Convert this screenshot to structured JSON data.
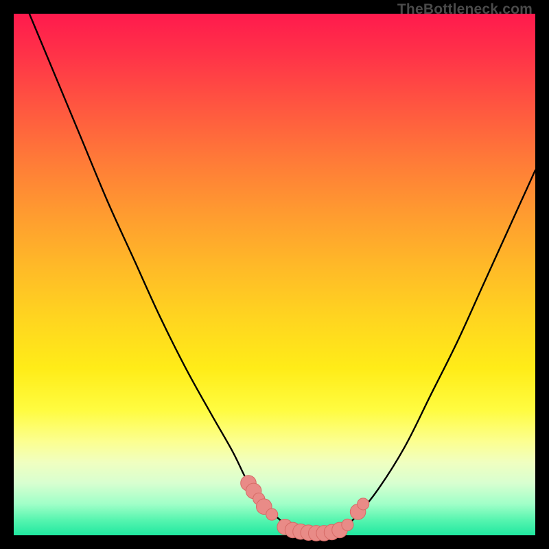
{
  "watermark": "TheBottleneck.com",
  "chart_data": {
    "type": "line",
    "title": "",
    "xlabel": "",
    "ylabel": "",
    "xlim": [
      0,
      100
    ],
    "ylim": [
      0,
      100
    ],
    "grid": false,
    "legend": false,
    "series": [
      {
        "name": "left-curve",
        "x": [
          3,
          8,
          13,
          18,
          23,
          28,
          33,
          38,
          42,
          45,
          48,
          51,
          54
        ],
        "y": [
          100,
          88,
          76,
          64,
          53,
          42,
          32,
          23,
          16,
          10,
          6,
          3,
          1
        ]
      },
      {
        "name": "right-curve",
        "x": [
          63,
          66,
          70,
          75,
          80,
          85,
          90,
          95,
          100
        ],
        "y": [
          1,
          4,
          9,
          17,
          27,
          37,
          48,
          59,
          70
        ]
      },
      {
        "name": "valley-floor",
        "x": [
          54,
          56,
          58,
          60,
          62,
          63
        ],
        "y": [
          1,
          0.5,
          0.3,
          0.3,
          0.5,
          1
        ]
      }
    ],
    "markers": [
      {
        "series": "left-curve",
        "x": 45,
        "y": 10,
        "r": 1.6
      },
      {
        "series": "left-curve",
        "x": 46,
        "y": 8.5,
        "r": 1.6
      },
      {
        "series": "left-curve",
        "x": 47,
        "y": 7,
        "r": 1.0
      },
      {
        "series": "left-curve",
        "x": 48,
        "y": 5.5,
        "r": 1.6
      },
      {
        "series": "left-curve",
        "x": 49.5,
        "y": 4,
        "r": 1.0
      },
      {
        "series": "valley-floor",
        "x": 52,
        "y": 1.6,
        "r": 1.6
      },
      {
        "series": "valley-floor",
        "x": 53.5,
        "y": 1.0,
        "r": 1.6
      },
      {
        "series": "valley-floor",
        "x": 55,
        "y": 0.7,
        "r": 1.6
      },
      {
        "series": "valley-floor",
        "x": 56.5,
        "y": 0.5,
        "r": 1.6
      },
      {
        "series": "valley-floor",
        "x": 58,
        "y": 0.4,
        "r": 1.6
      },
      {
        "series": "valley-floor",
        "x": 59.5,
        "y": 0.4,
        "r": 1.6
      },
      {
        "series": "valley-floor",
        "x": 61,
        "y": 0.6,
        "r": 1.6
      },
      {
        "series": "valley-floor",
        "x": 62.5,
        "y": 1.0,
        "r": 1.6
      },
      {
        "series": "right-curve",
        "x": 64,
        "y": 2.0,
        "r": 1.0
      },
      {
        "series": "right-curve",
        "x": 66,
        "y": 4.5,
        "r": 1.6
      },
      {
        "series": "right-curve",
        "x": 67,
        "y": 6.0,
        "r": 1.0
      }
    ],
    "colors": {
      "curve": "#000000",
      "marker_fill": "#e98b87",
      "marker_stroke": "#d66a66"
    }
  }
}
